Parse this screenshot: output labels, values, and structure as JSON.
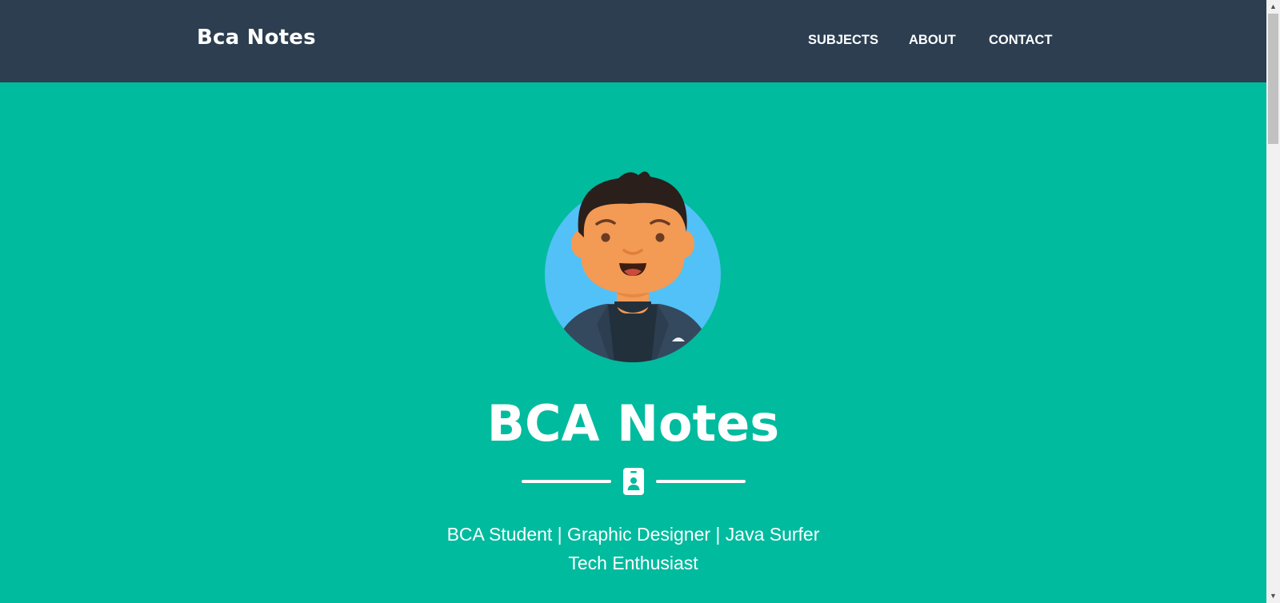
{
  "navbar": {
    "brand": "Bca Notes",
    "links": [
      {
        "label": "SUBJECTS"
      },
      {
        "label": "ABOUT"
      },
      {
        "label": "CONTACT"
      }
    ],
    "background": "#2c3e50"
  },
  "masthead": {
    "avatar_icon": "avatar-illustration",
    "heading": "BCA Notes",
    "divider_icon": "id-badge-icon",
    "subtitle_lines": [
      "BCA Student | Graphic Designer | Java Surfer",
      "Tech Enthusiast"
    ],
    "background": "#00bb9e"
  },
  "scrollbar": {
    "up_icon": "scroll-up-arrow-icon",
    "down_icon": "scroll-down-arrow-icon"
  }
}
